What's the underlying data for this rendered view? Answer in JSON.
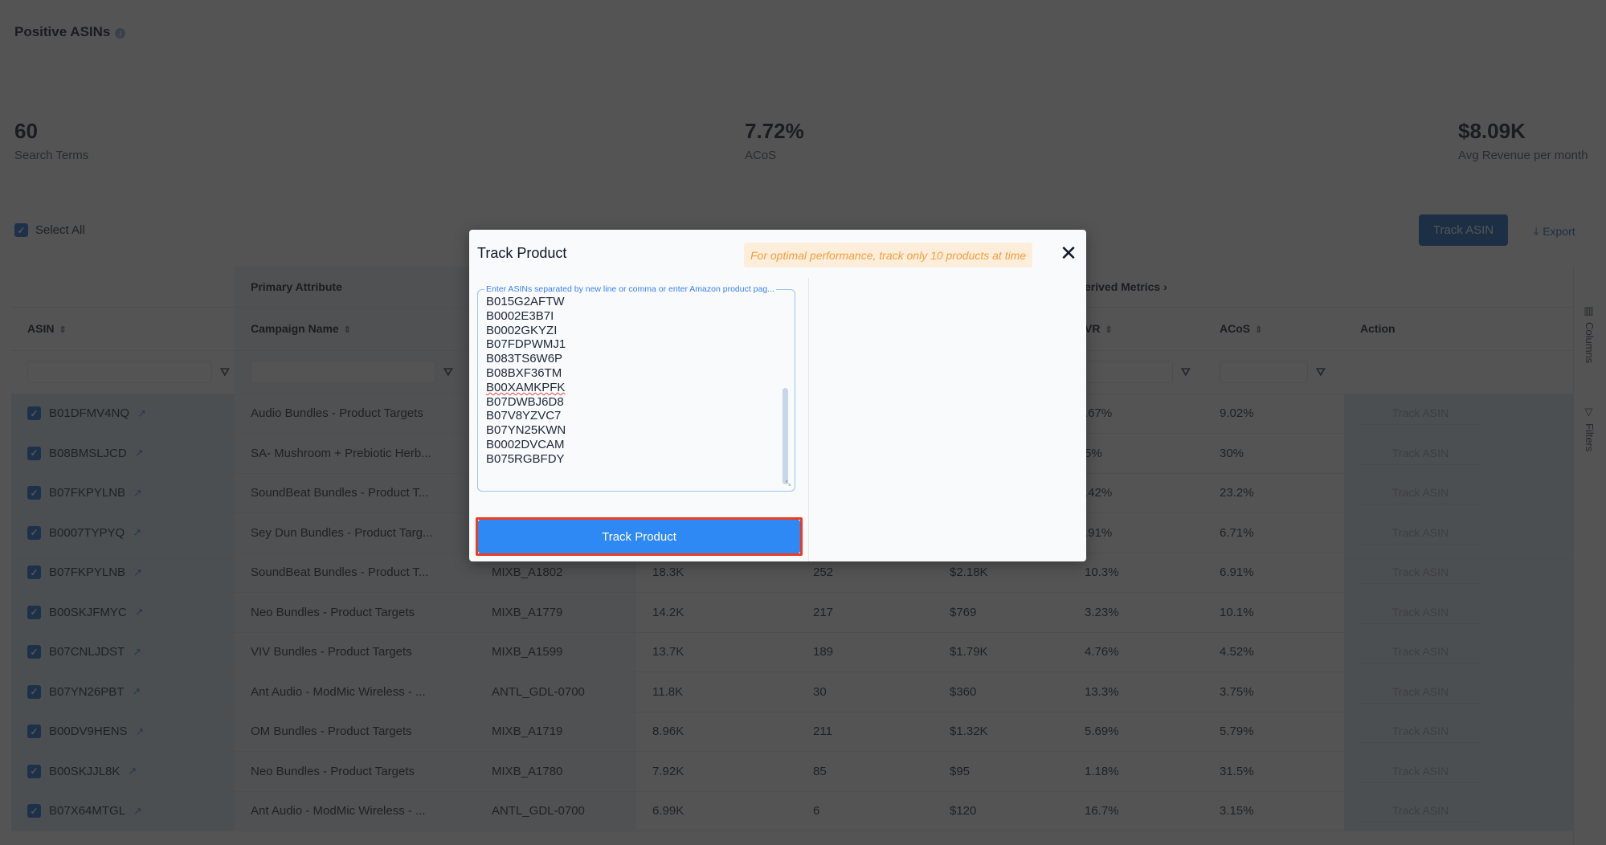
{
  "page": {
    "title": "Positive ASINs",
    "info_icon": "info-icon"
  },
  "kpis": [
    {
      "value": "60",
      "label": "Search Terms"
    },
    {
      "value": "7.72%",
      "label": "ACoS"
    },
    {
      "value": "$8.09K",
      "label": "Avg Revenue per month"
    }
  ],
  "toolbar": {
    "select_all_label": "Select All",
    "select_all_checked": true,
    "track_asin_label": "Track ASIN",
    "export_label": "Export",
    "export_icon": "download-icon"
  },
  "table": {
    "group_headers": {
      "primary": "Primary Attribute",
      "derived": "Derived Metrics",
      "derived_visible": "erived Metrics"
    },
    "columns": {
      "asin": "ASIN",
      "campaign": "Campaign Name",
      "cvr_visible": "VR",
      "acos": "ACoS",
      "action": "Action"
    },
    "rows": [
      {
        "asin": "B01DFMV4NQ",
        "campaign": "Audio Bundles - Product Targets",
        "cvr": ".67%",
        "acos": "9.02%",
        "action": "Track ASIN"
      },
      {
        "asin": "B08BMSLJCD",
        "campaign": "SA- Mushroom + Prebiotic Herb...",
        "cvr": "5%",
        "acos": "30%",
        "action": "Track ASIN"
      },
      {
        "asin": "B07FKPYLNB",
        "campaign": "SoundBeat Bundles - Product T...",
        "cvr": ".42%",
        "acos": "23.2%",
        "action": "Track ASIN"
      },
      {
        "asin": "B0007TYPYQ",
        "campaign": "Sey Dun Bundles - Product Targ...",
        "cvr": ".91%",
        "acos": "6.71%",
        "action": "Track ASIN"
      },
      {
        "asin": "B07FKPYLNB",
        "campaign": "SoundBeat Bundles - Product T...",
        "ad_group": "MIXB_A1802",
        "c1": "18.3K",
        "c2": "252",
        "c3": "$2.18K",
        "cvr": "10.3%",
        "acos": "6.91%",
        "action": "Track ASIN"
      },
      {
        "asin": "B00SKJFMYC",
        "campaign": "Neo Bundles - Product Targets",
        "ad_group": "MIXB_A1779",
        "c1": "14.2K",
        "c2": "217",
        "c3": "$769",
        "cvr": "3.23%",
        "acos": "10.1%",
        "action": "Track ASIN"
      },
      {
        "asin": "B07CNLJDST",
        "campaign": "VIV Bundles - Product Targets",
        "ad_group": "MIXB_A1599",
        "c1": "13.7K",
        "c2": "189",
        "c3": "$1.79K",
        "cvr": "4.76%",
        "acos": "4.52%",
        "action": "Track ASIN"
      },
      {
        "asin": "B07YN26PBT",
        "campaign": "Ant Audio - ModMic Wireless - ...",
        "ad_group": "ANTL_GDL-0700",
        "c1": "11.8K",
        "c2": "30",
        "c3": "$360",
        "cvr": "13.3%",
        "acos": "3.75%",
        "action": "Track ASIN"
      },
      {
        "asin": "B00DV9HENS",
        "campaign": "OM Bundles - Product Targets",
        "ad_group": "MIXB_A1719",
        "c1": "8.96K",
        "c2": "211",
        "c3": "$1.32K",
        "cvr": "5.69%",
        "acos": "5.79%",
        "action": "Track ASIN"
      },
      {
        "asin": "B00SKJJL8K",
        "campaign": "Neo Bundles - Product Targets",
        "ad_group": "MIXB_A1780",
        "c1": "7.92K",
        "c2": "85",
        "c3": "$95",
        "cvr": "1.18%",
        "acos": "31.5%",
        "action": "Track ASIN"
      },
      {
        "asin": "B07X64MTGL",
        "campaign": "Ant Audio - ModMic Wireless - ...",
        "ad_group": "ANTL_GDL-0700",
        "c1": "6.99K",
        "c2": "6",
        "c3": "$120",
        "cvr": "16.7%",
        "acos": "3.15%",
        "action": "Track ASIN"
      }
    ]
  },
  "side_rail": {
    "columns_label": "Columns",
    "filters_label": "Filters"
  },
  "modal": {
    "title": "Track Product",
    "warning": "For optimal performance, track only 10 products at time",
    "close_icon": "close-icon",
    "textarea_label": "Enter ASINs separated by new line or comma or enter Amazon product pag...",
    "textarea_lines": [
      "B015G2AFTW",
      "B0002E3B7I",
      "B0002GKYZI",
      "B07FDPWMJ1",
      "B083TS6W6P",
      "B08BXF36TM",
      "B00XAMKPFK",
      "B07DWBJ6D8",
      "B07V8YZVC7",
      "B07YN25KWN",
      "B0002DVCAM",
      "B075RGBFDY"
    ],
    "misspelled_line_index": 6,
    "submit_label": "Track Product"
  },
  "colors": {
    "primary": "#1565c0",
    "submit_button": "#2f89f5",
    "highlight_outline": "#ee3a1f",
    "warning_text": "#f59e3b",
    "warning_bg": "#fdeedc"
  }
}
